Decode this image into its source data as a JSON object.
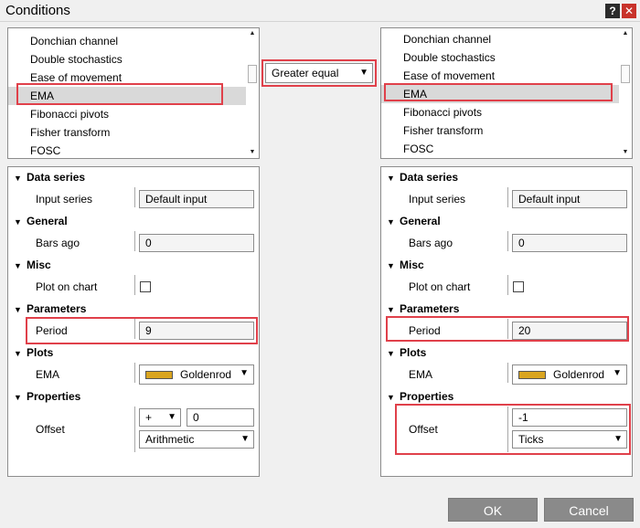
{
  "window": {
    "title": "Conditions",
    "help_label": "?",
    "close_label": "✕"
  },
  "left_list": {
    "items": [
      "Donchian channel",
      "Double stochastics",
      "Ease of movement",
      "EMA",
      "Fibonacci pivots",
      "Fisher transform",
      "FOSC"
    ],
    "selected": "EMA"
  },
  "right_list": {
    "items": [
      "Donchian channel",
      "Double stochastics",
      "Ease of movement",
      "EMA",
      "Fibonacci pivots",
      "Fisher transform",
      "FOSC"
    ],
    "selected": "EMA"
  },
  "operator": {
    "value": "Greater equal"
  },
  "left_props": {
    "data_series": "Data series",
    "input_series_label": "Input series",
    "input_series_value": "Default input",
    "general": "General",
    "bars_ago_label": "Bars ago",
    "bars_ago_value": "0",
    "misc": "Misc",
    "plot_on_chart_label": "Plot on chart",
    "parameters": "Parameters",
    "period_label": "Period",
    "period_value": "9",
    "plots": "Plots",
    "ema_label": "EMA",
    "ema_color": "Goldenrod",
    "properties": "Properties",
    "offset_label": "Offset",
    "offset_op": "+",
    "offset_value": "0",
    "offset_type": "Arithmetic"
  },
  "right_props": {
    "data_series": "Data series",
    "input_series_label": "Input series",
    "input_series_value": "Default input",
    "general": "General",
    "bars_ago_label": "Bars ago",
    "bars_ago_value": "0",
    "misc": "Misc",
    "plot_on_chart_label": "Plot on chart",
    "parameters": "Parameters",
    "period_label": "Period",
    "period_value": "20",
    "plots": "Plots",
    "ema_label": "EMA",
    "ema_color": "Goldenrod",
    "properties": "Properties",
    "offset_label": "Offset",
    "offset_value": "-1",
    "offset_type": "Ticks"
  },
  "buttons": {
    "ok": "OK",
    "cancel": "Cancel"
  },
  "colors": {
    "highlight": "#e0404a",
    "goldenrod": "#daa520",
    "button_bg": "#8a8a8a"
  }
}
